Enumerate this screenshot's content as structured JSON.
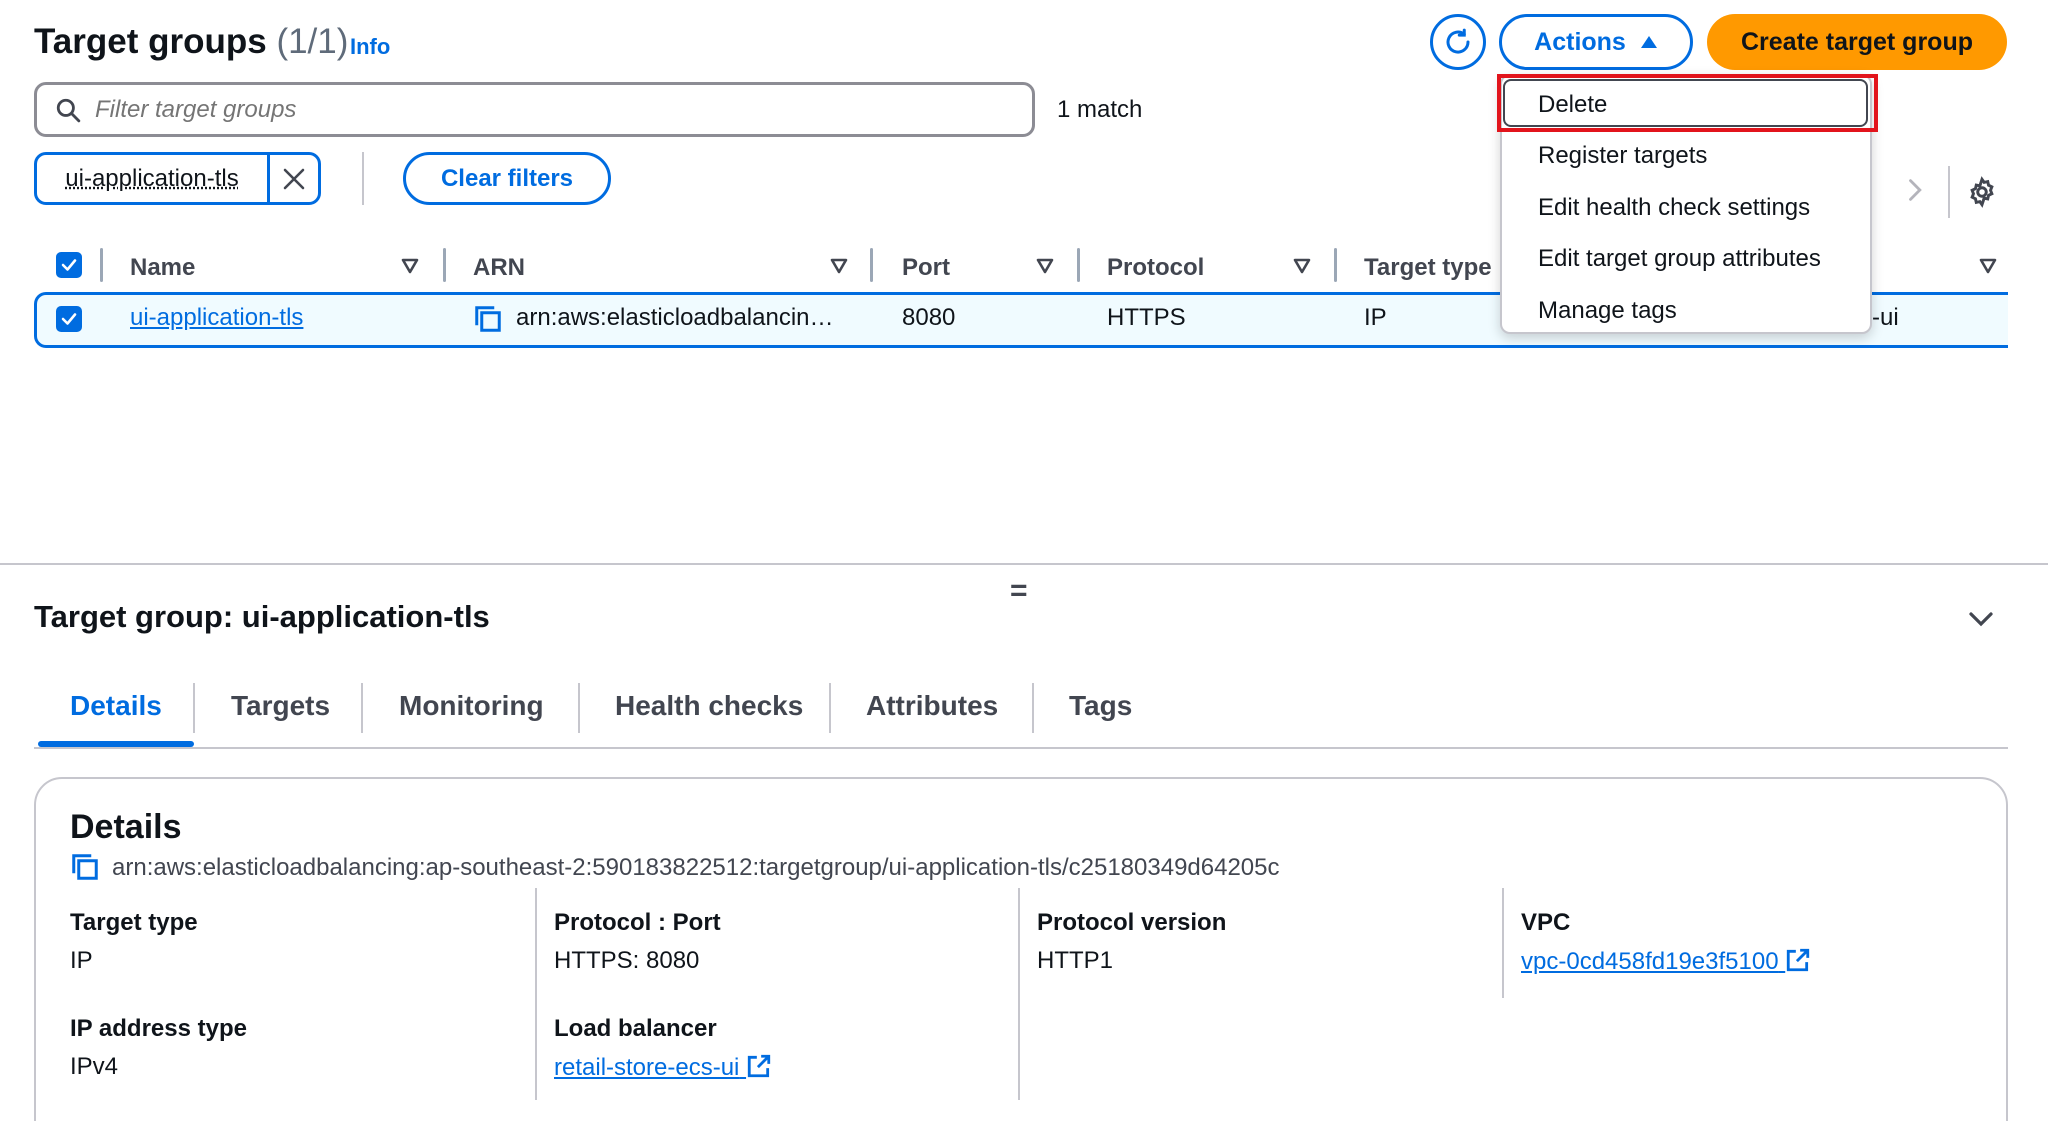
{
  "header": {
    "title": "Target groups",
    "count": "(1/1)",
    "info": "Info",
    "actions_label": "Actions",
    "create_label": "Create target group"
  },
  "filter": {
    "placeholder": "Filter target groups",
    "match_text": "1 match",
    "token_label": "ui-application-tls",
    "clear_label": "Clear filters"
  },
  "table": {
    "columns": [
      "Name",
      "ARN",
      "Port",
      "Protocol",
      "Target type"
    ],
    "row": {
      "name": "ui-application-tls",
      "arn": "arn:aws:elasticloadbalancin…",
      "port": "8080",
      "protocol": "HTTPS",
      "target_type": "IP",
      "extra": "-ui"
    }
  },
  "actions_menu": {
    "items": [
      "Delete",
      "Register targets",
      "Edit health check settings",
      "Edit target group attributes",
      "Manage tags"
    ]
  },
  "panel": {
    "title": "Target group: ui-application-tls",
    "tabs": [
      "Details",
      "Targets",
      "Monitoring",
      "Health checks",
      "Attributes",
      "Tags"
    ],
    "details": {
      "heading": "Details",
      "arn": "arn:aws:elasticloadbalancing:ap-southeast-2:590183822512:targetgroup/ui-application-tls/c25180349d64205c",
      "target_type_label": "Target type",
      "target_type_value": "IP",
      "protocol_port_label": "Protocol : Port",
      "protocol_port_value": "HTTPS: 8080",
      "protocol_version_label": "Protocol version",
      "protocol_version_value": "HTTP1",
      "vpc_label": "VPC",
      "vpc_value": "vpc-0cd458fd19e3f5100",
      "ip_type_label": "IP address type",
      "ip_type_value": "IPv4",
      "lb_label": "Load balancer",
      "lb_value": "retail-store-ecs-ui"
    }
  },
  "colors": {
    "accent": "#006ce0",
    "primary_button": "#ff9900",
    "highlight": "#e2141c"
  }
}
